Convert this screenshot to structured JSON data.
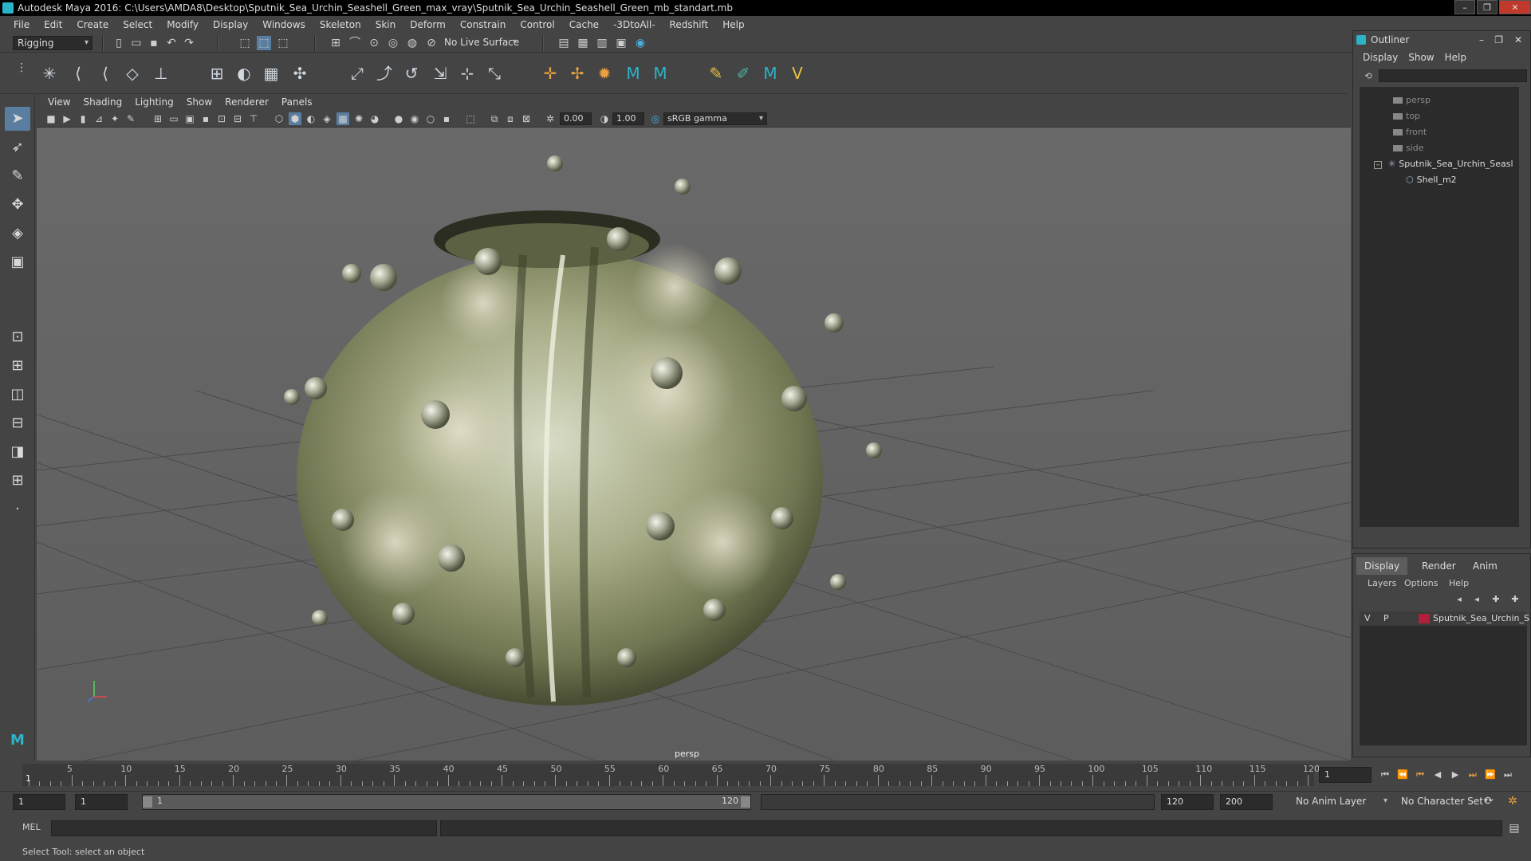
{
  "window": {
    "title": "Autodesk Maya 2016: C:\\Users\\AMDA8\\Desktop\\Sputnik_Sea_Urchin_Seashell_Green_max_vray\\Sputnik_Sea_Urchin_Seashell_Green_mb_standart.mb",
    "min": "–",
    "max": "❐",
    "close": "✕"
  },
  "menubar": [
    "File",
    "Edit",
    "Create",
    "Select",
    "Modify",
    "Display",
    "Windows",
    "Skeleton",
    "Skin",
    "Deform",
    "Constrain",
    "Control",
    "Cache",
    "-3DtoAll-",
    "Redshift",
    "Help"
  ],
  "shelf": {
    "mode": "Rigging",
    "live_surface": "No Live Surface"
  },
  "viewport": {
    "menu": [
      "View",
      "Shading",
      "Lighting",
      "Show",
      "Renderer",
      "Panels"
    ],
    "exposure": "0.00",
    "gamma": "1.00",
    "colorspace": "sRGB gamma",
    "camera": "persp"
  },
  "outliner": {
    "title": "Outliner",
    "menu": [
      "Display",
      "Show",
      "Help"
    ],
    "items": [
      {
        "label": "persp",
        "type": "camera"
      },
      {
        "label": "top",
        "type": "camera"
      },
      {
        "label": "front",
        "type": "camera"
      },
      {
        "label": "side",
        "type": "camera"
      },
      {
        "label": "Sputnik_Sea_Urchin_Seasl",
        "type": "group"
      },
      {
        "label": "Shell_m2",
        "type": "mesh"
      }
    ]
  },
  "channelbox": {
    "tabs": [
      "Display",
      "Render",
      "Anim"
    ],
    "menu": [
      "Layers",
      "Options",
      "Help"
    ],
    "layer": {
      "v": "V",
      "p": "P",
      "name": "Sputnik_Sea_Urchin_S",
      "color": "#b0203a"
    }
  },
  "timeline": {
    "labels": [
      "5",
      "10",
      "15",
      "20",
      "25",
      "30",
      "35",
      "40",
      "45",
      "50",
      "55",
      "60",
      "65",
      "70",
      "75",
      "80",
      "85",
      "90",
      "95",
      "100",
      "105",
      "110",
      "115",
      "120"
    ],
    "start": 1,
    "end": 120,
    "current": "1",
    "current_frame_field": "1"
  },
  "range": {
    "start": "1",
    "start2": "1",
    "slider_start": "1",
    "slider_end": "120",
    "end": "120",
    "max": "200",
    "anim_layer": "No Anim Layer",
    "char_set": "No Character Set"
  },
  "mel": {
    "label": "MEL"
  },
  "status": {
    "text": "Select Tool: select an object"
  },
  "colors": {
    "accent": "#5a7ea0",
    "layer": "#b0203a"
  }
}
